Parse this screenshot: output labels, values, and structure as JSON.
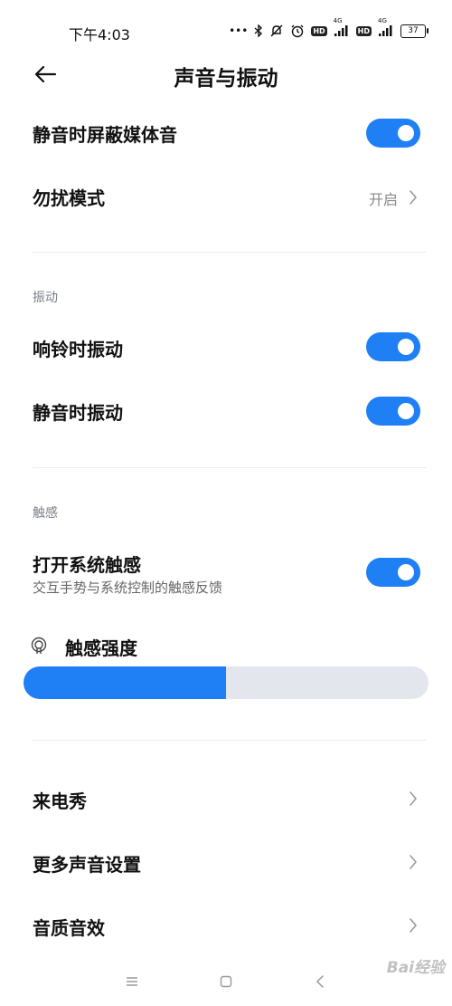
{
  "status_bar": {
    "time": "下午4:03",
    "dots": "•••",
    "hd1": "HD",
    "hd2": "HD",
    "net1": "4G",
    "net2": "4G",
    "battery": "37"
  },
  "header": {
    "title": "声音与振动"
  },
  "items": {
    "mute_media": {
      "label": "静音时屏蔽媒体音",
      "enabled": true
    },
    "dnd": {
      "label": "勿扰模式",
      "value": "开启"
    },
    "ring_vibrate": {
      "label": "响铃时振动",
      "enabled": true
    },
    "silent_vibrate": {
      "label": "静音时振动",
      "enabled": true
    },
    "haptics": {
      "label": "打开系统触感",
      "sub": "交互手势与系统控制的触感反馈",
      "enabled": true
    },
    "ringtone_show": {
      "label": "来电秀"
    },
    "more_sound": {
      "label": "更多声音设置"
    },
    "sound_quality": {
      "label": "音质音效"
    }
  },
  "sections": {
    "vibration": "振动",
    "haptics": "触感"
  },
  "haptic_strength": {
    "label": "触感强度",
    "level": 0.5
  },
  "colors": {
    "accent": "#1f7ff5",
    "track": "#e3e6ed"
  },
  "watermark": "Bai经验"
}
